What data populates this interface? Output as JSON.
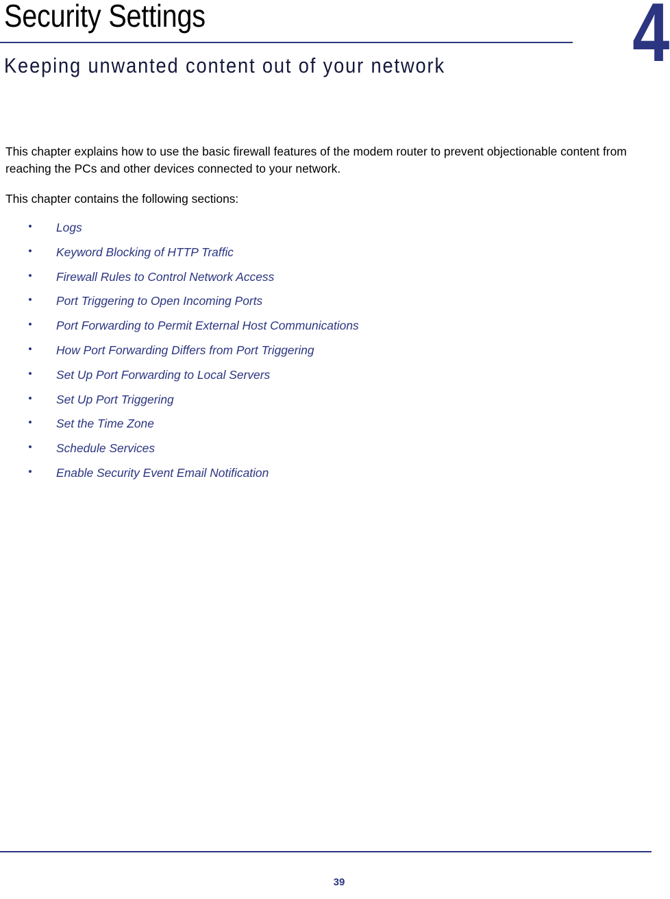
{
  "header": {
    "title": "Security Settings",
    "chapter_number": "4",
    "subtitle": "Keeping unwanted content out of your network",
    "rule_color": "#2B3580",
    "number_color": "#2B3580",
    "title_color": "#000000"
  },
  "body": {
    "paragraphs": [
      "This chapter explains how to use the basic firewall features of the modem router to prevent objectionable content from reaching the PCs and other devices connected to your network.",
      "This chapter contains the following sections:"
    ]
  },
  "sections": {
    "link_color": "#2B3580",
    "items": [
      {
        "label": "Logs"
      },
      {
        "label": "Keyword Blocking of HTTP Traffic"
      },
      {
        "label": "Firewall Rules to Control Network Access"
      },
      {
        "label": "Port Triggering to Open Incoming Ports"
      },
      {
        "label": "Port Forwarding to Permit External Host Communications"
      },
      {
        "label": "How Port Forwarding Differs from Port Triggering"
      },
      {
        "label": "Set Up Port Forwarding to Local Servers"
      },
      {
        "label": "Set Up Port Triggering"
      },
      {
        "label": "Set the Time Zone"
      },
      {
        "label": "Schedule Services"
      },
      {
        "label": "Enable Security Event Email Notification"
      }
    ]
  },
  "footer": {
    "page_number": "39",
    "rule_color": "#2B3580"
  }
}
